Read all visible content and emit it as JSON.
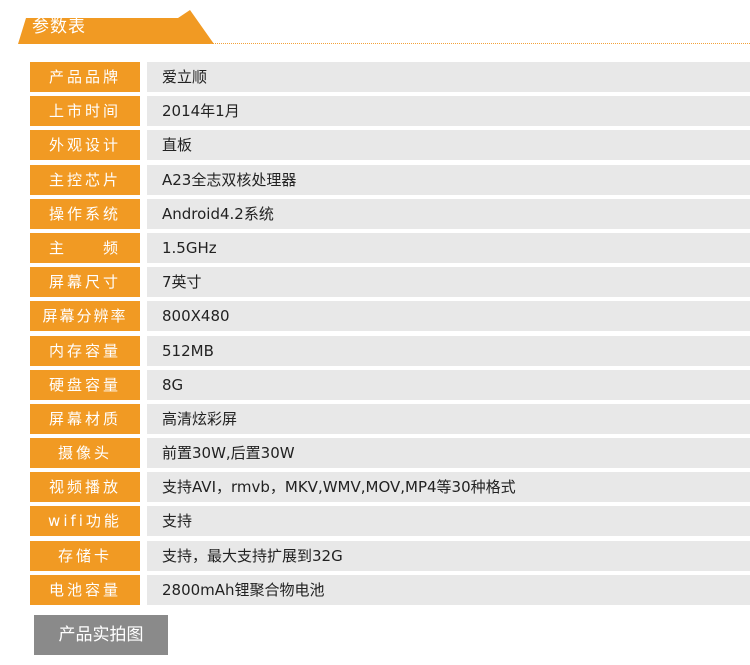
{
  "header": {
    "title": "参数表",
    "accent_color": "#f19a23"
  },
  "specs": [
    {
      "label": "产品品牌",
      "value": "爱立顺"
    },
    {
      "label": "上市时间",
      "value": "2014年1月"
    },
    {
      "label": "外观设计",
      "value": "直板"
    },
    {
      "label": "主控芯片",
      "value": "A23全志双核处理器"
    },
    {
      "label": "操作系统",
      "value": "Android4.2系统"
    },
    {
      "label": "主　　频",
      "value": "1.5GHz"
    },
    {
      "label": "屏幕尺寸",
      "value": "7英寸"
    },
    {
      "label": "屏幕分辨率",
      "value": "800X480"
    },
    {
      "label": "内存容量",
      "value": "512MB"
    },
    {
      "label": "硬盘容量",
      "value": "8G"
    },
    {
      "label": "屏幕材质",
      "value": "高清炫彩屏"
    },
    {
      "label": "摄像头",
      "value": "前置30W,后置30W"
    },
    {
      "label": "视频播放",
      "value": "支持AVI，rmvb，MKV,WMV,MOV,MP4等30种格式"
    },
    {
      "label": "wifi功能",
      "value": "支持"
    },
    {
      "label": "存储卡",
      "value": "支持，最大支持扩展到32G"
    },
    {
      "label": "电池容量",
      "value": "2800mAh锂聚合物电池"
    }
  ],
  "footer": {
    "photo_button_label": "产品实拍图"
  }
}
